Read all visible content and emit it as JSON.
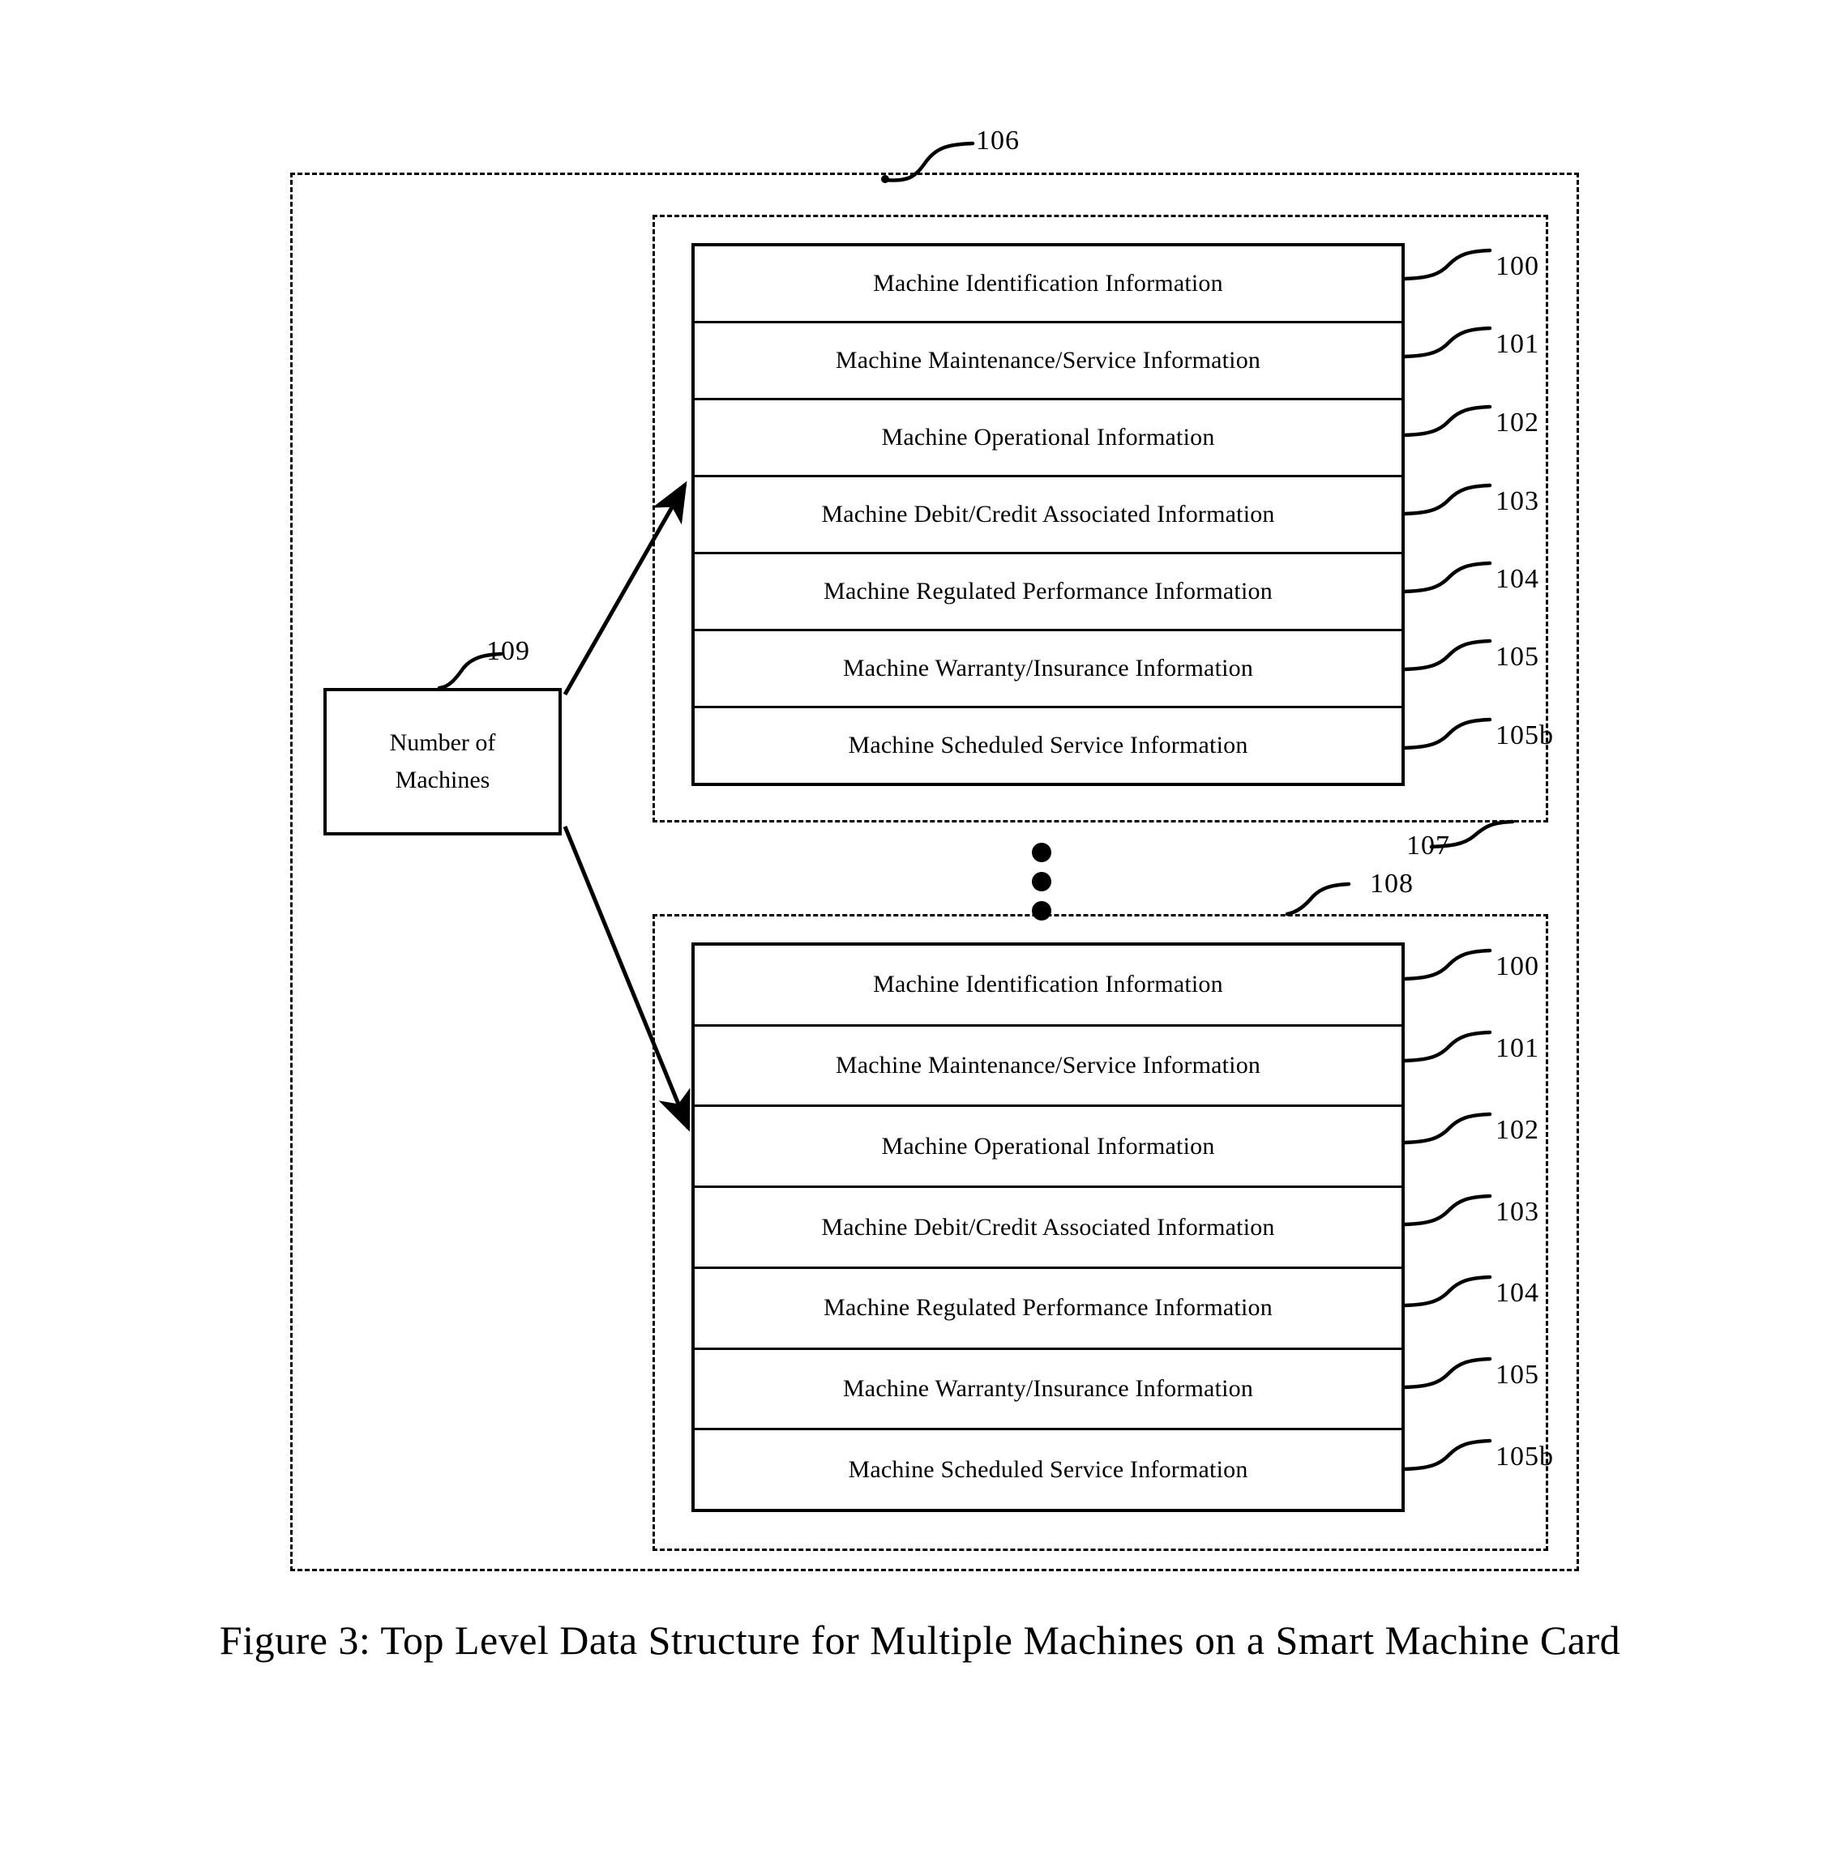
{
  "figure": {
    "caption": "Figure 3: Top Level Data Structure for Multiple Machines on a Smart Machine Card",
    "outer_card_ref": "106",
    "machine_group_top_ref": "107",
    "machine_group_bottom_ref": "108"
  },
  "number_of_machines": {
    "ref": "109",
    "line1": "Number of",
    "line2": "Machines"
  },
  "record_rows": [
    {
      "label": "Machine Identification Information",
      "ref": "100"
    },
    {
      "label": "Machine Maintenance/Service Information",
      "ref": "101"
    },
    {
      "label": "Machine Operational Information",
      "ref": "102"
    },
    {
      "label": "Machine Debit/Credit Associated Information",
      "ref": "103"
    },
    {
      "label": "Machine Regulated Performance Information",
      "ref": "104"
    },
    {
      "label": "Machine Warranty/Insurance Information",
      "ref": "105"
    },
    {
      "label": "Machine Scheduled Service Information",
      "ref": "105b"
    }
  ],
  "record_table_top": {
    "rows": [
      {
        "label": "Machine Identification Information",
        "ref": "100"
      },
      {
        "label": "Machine Maintenance/Service Information",
        "ref": "101"
      },
      {
        "label": "Machine Operational Information",
        "ref": "102"
      },
      {
        "label": "Machine Debit/Credit Associated Information",
        "ref": "103"
      },
      {
        "label": "Machine Regulated Performance Information",
        "ref": "104"
      },
      {
        "label": "Machine Warranty/Insurance Information",
        "ref": "105"
      },
      {
        "label": "Machine Scheduled Service Information",
        "ref": "105b"
      }
    ]
  },
  "record_table_bottom": {
    "rows": [
      {
        "label": "Machine Identification Information",
        "ref": "100"
      },
      {
        "label": "Machine Maintenance/Service Information",
        "ref": "101"
      },
      {
        "label": "Machine Operational Information",
        "ref": "102"
      },
      {
        "label": "Machine Debit/Credit Associated Information",
        "ref": "103"
      },
      {
        "label": "Machine Regulated Performance Information",
        "ref": "104"
      },
      {
        "label": "Machine Warranty/Insurance Information",
        "ref": "105"
      },
      {
        "label": "Machine Scheduled Service Information",
        "ref": "105b"
      }
    ]
  },
  "continuation": {
    "symbol": "vertical-ellipsis",
    "dot_count": 3
  },
  "colors": {
    "ink": "#000000",
    "paper": "#ffffff"
  }
}
